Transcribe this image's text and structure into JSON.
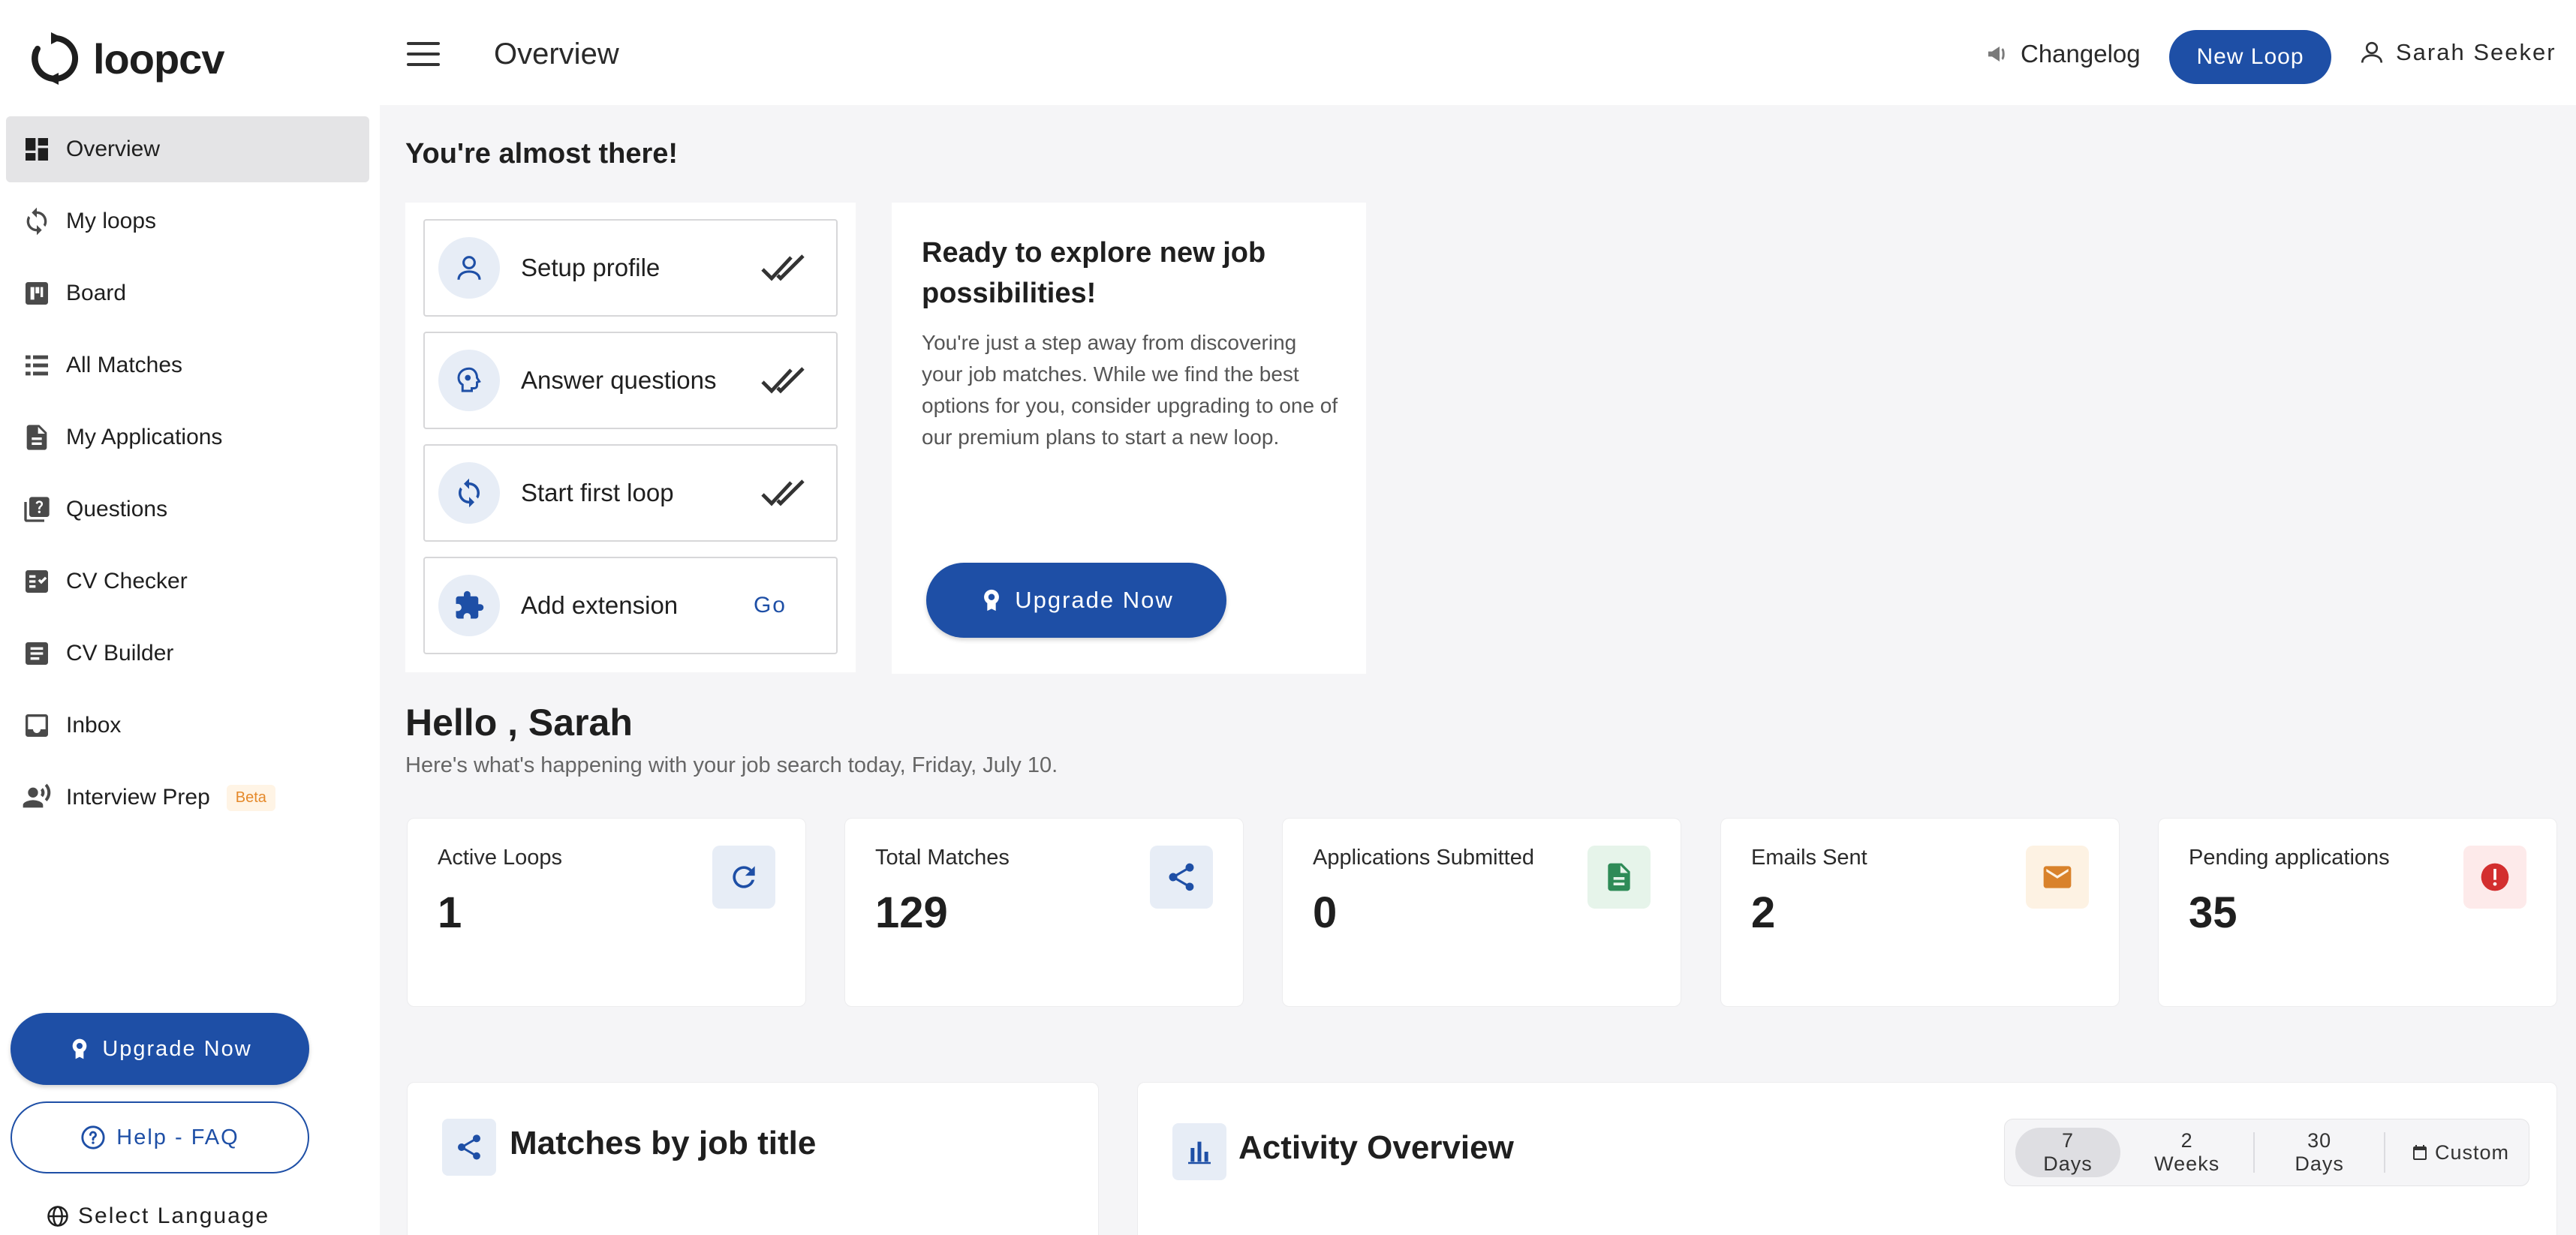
{
  "app": {
    "name": "loopcv"
  },
  "header": {
    "title": "Overview",
    "changelog": "Changelog",
    "new_loop": "New Loop",
    "user_name": "Sarah Seeker"
  },
  "sidebar": {
    "items": [
      {
        "label": "Overview",
        "icon": "dashboard-icon",
        "active": true
      },
      {
        "label": "My loops",
        "icon": "sync-icon"
      },
      {
        "label": "Board",
        "icon": "board-icon"
      },
      {
        "label": "All Matches",
        "icon": "list-icon"
      },
      {
        "label": "My Applications",
        "icon": "document-icon"
      },
      {
        "label": "Questions",
        "icon": "question-book-icon"
      },
      {
        "label": "CV Checker",
        "icon": "checklist-icon"
      },
      {
        "label": "CV Builder",
        "icon": "article-icon"
      },
      {
        "label": "Inbox",
        "icon": "inbox-icon"
      },
      {
        "label": "Interview Prep",
        "icon": "interview-icon",
        "badge": "Beta"
      }
    ],
    "upgrade": "Upgrade Now",
    "help": "Help - FAQ",
    "language": "Select Language"
  },
  "onboarding": {
    "heading": "You're almost there!",
    "steps": [
      {
        "label": "Setup profile",
        "status": "done"
      },
      {
        "label": "Answer questions",
        "status": "done"
      },
      {
        "label": "Start first loop",
        "status": "done"
      },
      {
        "label": "Add extension",
        "status": "pending",
        "action": "Go"
      }
    ]
  },
  "explore": {
    "title": "Ready to explore new job possibilities!",
    "text": "You're just a step away from discovering your job matches. While we find the best options for you, consider upgrading to one of our premium plans to start a new loop.",
    "button": "Upgrade Now"
  },
  "greeting": {
    "title": "Hello , Sarah",
    "subtitle": "Here's what's happening with your job search today, Friday, July 10."
  },
  "stats": [
    {
      "label": "Active Loops",
      "value": "1",
      "icon": "refresh-icon",
      "color": "#1e4fa6",
      "bg": "#e7edf6"
    },
    {
      "label": "Total Matches",
      "value": "129",
      "icon": "share-icon",
      "color": "#1e4fa6",
      "bg": "#e7edf6"
    },
    {
      "label": "Applications Submitted",
      "value": "0",
      "icon": "document-icon",
      "color": "#2e8b57",
      "bg": "#e6f4ea"
    },
    {
      "label": "Emails Sent",
      "value": "2",
      "icon": "mail-icon",
      "color": "#d9822b",
      "bg": "#fdf2e3"
    },
    {
      "label": "Pending applications",
      "value": "35",
      "icon": "alert-icon",
      "color": "#d32f2f",
      "bg": "#fdeaea"
    }
  ],
  "panels": {
    "matches_title": "Matches by job title",
    "activity_title": "Activity Overview",
    "ranges": [
      "7 Days",
      "2 Weeks",
      "30 Days",
      "Custom"
    ],
    "active_range": "7 Days"
  }
}
